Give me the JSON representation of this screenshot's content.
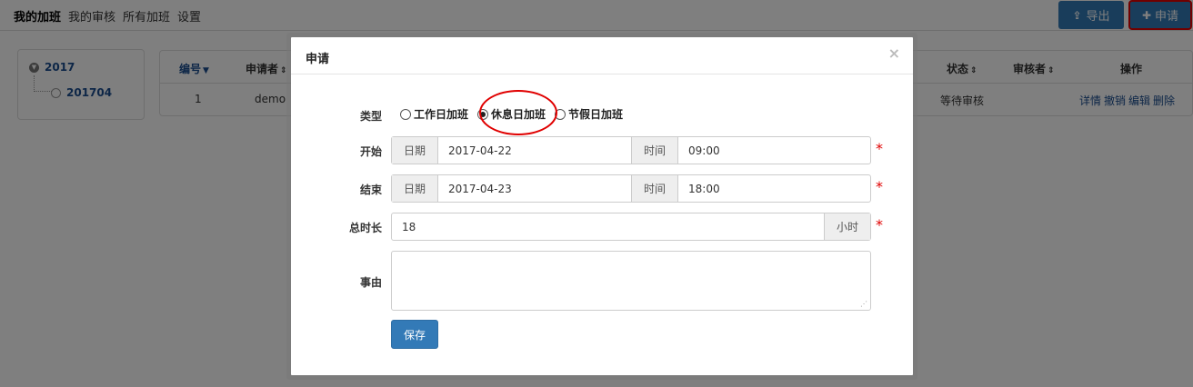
{
  "nav": {
    "links": [
      "我的加班",
      "我的审核",
      "所有加班",
      "设置"
    ],
    "export_label": "导出",
    "apply_label": "申请"
  },
  "tree": {
    "year": "2017",
    "month": "201704"
  },
  "table": {
    "headers": [
      "编号",
      "申请者",
      "状态",
      "审核者",
      "操作"
    ],
    "row": {
      "id": "1",
      "applicant": "demo",
      "status": "等待审核",
      "ops": [
        "详情",
        "撤销",
        "编辑",
        "删除"
      ]
    }
  },
  "modal": {
    "title": "申请",
    "close": "×",
    "type_label": "类型",
    "type_options": [
      "工作日加班",
      "休息日加班",
      "节假日加班"
    ],
    "type_selected": "休息日加班",
    "start_label": "开始",
    "end_label": "结束",
    "duration_label": "总时长",
    "reason_label": "事由",
    "date_addon": "日期",
    "time_addon": "时间",
    "start_date": "2017-04-22",
    "start_time": "09:00",
    "end_date": "2017-04-23",
    "end_time": "18:00",
    "duration": "18",
    "duration_unit": "小时",
    "required_mark": "*",
    "save_label": "保存"
  },
  "colors": {
    "primary": "#337ab7",
    "highlight": "#e00000",
    "link": "#1a4d8f"
  }
}
